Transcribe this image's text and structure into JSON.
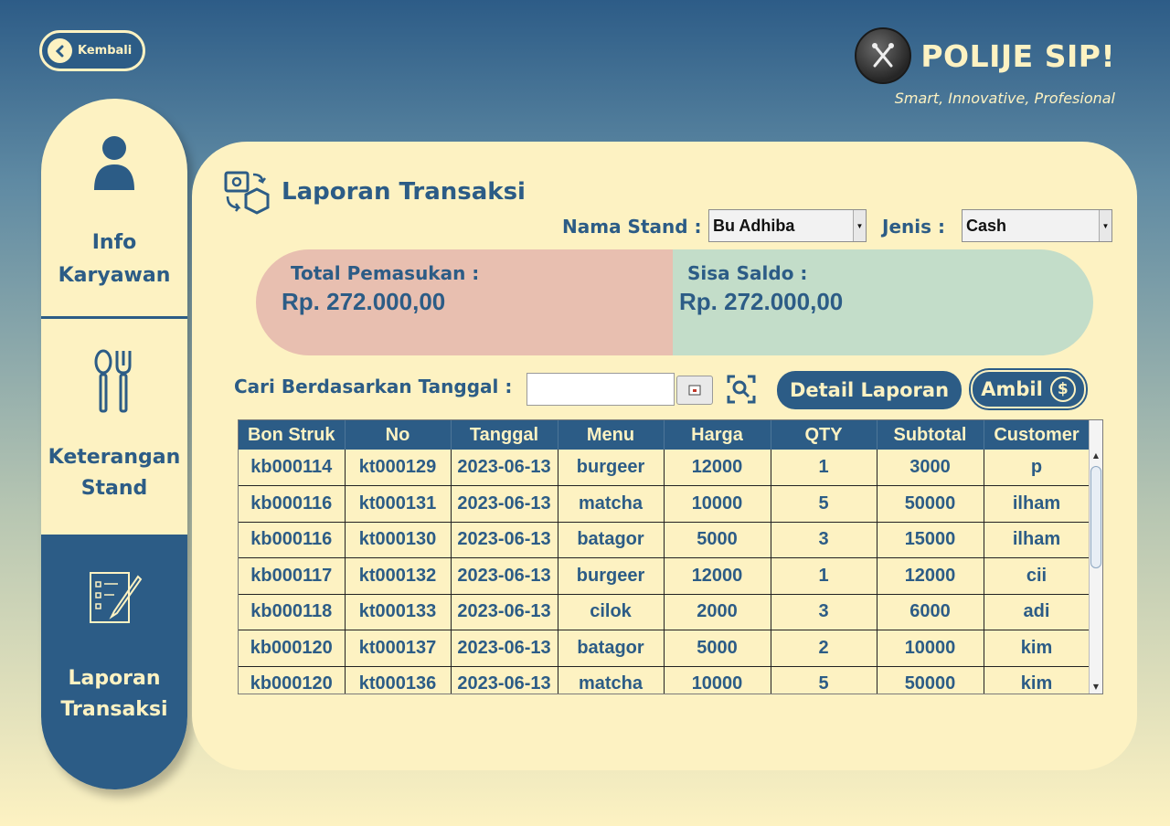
{
  "header": {
    "back_label": "Kembali",
    "brand_title": "POLIJE SIP!",
    "brand_subtitle": "Smart, Innovative, Profesional"
  },
  "sidebar": {
    "items": [
      {
        "label_line1": "Info",
        "label_line2": "Karyawan",
        "icon": "user-icon",
        "active": false
      },
      {
        "label_line1": "Keterangan",
        "label_line2": "Stand",
        "icon": "fork-knife-icon",
        "active": false
      },
      {
        "label_line1": "Laporan",
        "label_line2": "Transaksi",
        "icon": "checklist-pen-icon",
        "active": true
      }
    ]
  },
  "page": {
    "title": "Laporan Transaksi",
    "title_icon": "report-transfer-icon"
  },
  "filters": {
    "stand_label": "Nama Stand :",
    "stand_value": "Bu Adhiba",
    "jenis_label": "Jenis :",
    "jenis_value": "Cash"
  },
  "summary": {
    "income_label": "Total Pemasukan :",
    "income_value": "Rp. 272.000,00",
    "balance_label": "Sisa Saldo :",
    "balance_value": "Rp. 272.000,00",
    "income_color": "#e8bfb0",
    "balance_color": "#c3ddc9"
  },
  "search": {
    "label": "Cari Berdasarkan Tanggal :",
    "date_value": "",
    "detail_button": "Detail Laporan",
    "ambil_button": "Ambil",
    "ambil_icon": "$"
  },
  "table": {
    "columns": [
      "Bon Struk",
      "No",
      "Tanggal",
      "Menu",
      "Harga",
      "QTY",
      "Subtotal",
      "Customer"
    ],
    "rows": [
      [
        "kb000114",
        "kt000129",
        "2023-06-13",
        "burgeer",
        "12000",
        "1",
        "3000",
        "p"
      ],
      [
        "kb000116",
        "kt000131",
        "2023-06-13",
        "matcha",
        "10000",
        "5",
        "50000",
        "ilham"
      ],
      [
        "kb000116",
        "kt000130",
        "2023-06-13",
        "batagor",
        "5000",
        "3",
        "15000",
        "ilham"
      ],
      [
        "kb000117",
        "kt000132",
        "2023-06-13",
        "burgeer",
        "12000",
        "1",
        "12000",
        "cii"
      ],
      [
        "kb000118",
        "kt000133",
        "2023-06-13",
        "cilok",
        "2000",
        "3",
        "6000",
        "adi"
      ],
      [
        "kb000120",
        "kt000137",
        "2023-06-13",
        "batagor",
        "5000",
        "2",
        "10000",
        "kim"
      ],
      [
        "kb000120",
        "kt000136",
        "2023-06-13",
        "matcha",
        "10000",
        "5",
        "50000",
        "kim"
      ]
    ]
  },
  "colors": {
    "primary": "#2c5c86",
    "cream": "#fdf2c2"
  }
}
